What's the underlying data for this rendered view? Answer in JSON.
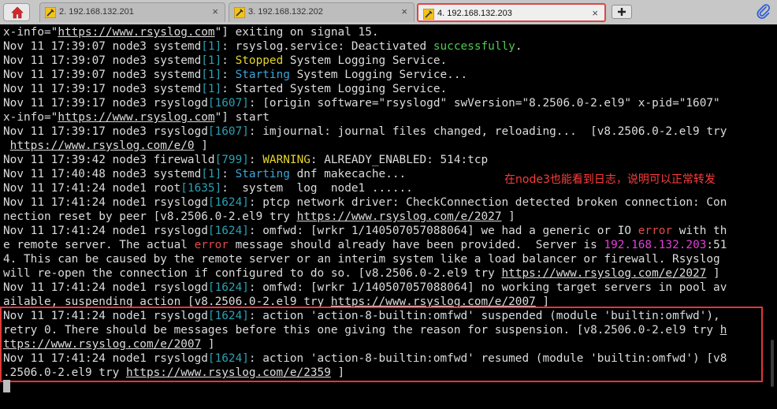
{
  "tabs": {
    "items": [
      {
        "label": "2. 192.168.132.201",
        "close": "×",
        "active": false
      },
      {
        "label": "3. 192.168.132.202",
        "close": "×",
        "active": false
      },
      {
        "label": "4. 192.168.132.203",
        "close": "×",
        "active": true
      }
    ],
    "new_tab_icon": "plus-icon",
    "home_icon": "home-icon",
    "attach_icon": "paperclip-icon"
  },
  "colors": {
    "url": "#dcdcdc",
    "pid": "#2aa1b3",
    "success": "#4fc94f",
    "warning": "#e5d52a",
    "starting": "#3aa6d8",
    "error": "#e24a4a",
    "ip": "#e040d8",
    "annotation": "#ff3b3b",
    "highlight_border": "#e03838"
  },
  "annotation": "在node3也能看到日志，说明可以正常转发",
  "terminal": {
    "lines": [
      [
        {
          "t": "x-info=\""
        },
        {
          "t": "https://www.rsyslog.com",
          "c": "url"
        },
        {
          "t": "\"] exiting on signal 15."
        }
      ],
      [
        {
          "t": "Nov 11 17:39:07 node3 systemd"
        },
        {
          "t": "[1]",
          "c": "num"
        },
        {
          "t": ": rsyslog.service: Deactivated "
        },
        {
          "t": "successfully",
          "c": "green"
        },
        {
          "t": "."
        }
      ],
      [
        {
          "t": "Nov 11 17:39:07 node3 systemd"
        },
        {
          "t": "[1]",
          "c": "num"
        },
        {
          "t": ": "
        },
        {
          "t": "Stopped",
          "c": "yellow"
        },
        {
          "t": " System Logging Service."
        }
      ],
      [
        {
          "t": "Nov 11 17:39:07 node3 systemd"
        },
        {
          "t": "[1]",
          "c": "num"
        },
        {
          "t": ": "
        },
        {
          "t": "Starting",
          "c": "cyan"
        },
        {
          "t": " System Logging Service..."
        }
      ],
      [
        {
          "t": "Nov 11 17:39:17 node3 systemd"
        },
        {
          "t": "[1]",
          "c": "num"
        },
        {
          "t": ": Started System Logging Service."
        }
      ],
      [
        {
          "t": "Nov 11 17:39:17 node3 rsyslogd"
        },
        {
          "t": "[1607]",
          "c": "num"
        },
        {
          "t": ": [origin software=\"rsyslogd\" swVersion=\"8.2506.0-2.el9\" x-pid=\"1607\""
        }
      ],
      [
        {
          "t": "x-info=\""
        },
        {
          "t": "https://www.rsyslog.com",
          "c": "url"
        },
        {
          "t": "\"] start"
        }
      ],
      [
        {
          "t": "Nov 11 17:39:17 node3 rsyslogd"
        },
        {
          "t": "[1607]",
          "c": "num"
        },
        {
          "t": ": imjournal: journal files changed, reloading...  [v8.2506.0-2.el9 try"
        }
      ],
      [
        {
          "t": " "
        },
        {
          "t": "https://www.rsyslog.com/e/0",
          "c": "url"
        },
        {
          "t": " ]"
        }
      ],
      [
        {
          "t": "Nov 11 17:39:42 node3 firewalld"
        },
        {
          "t": "[799]",
          "c": "num"
        },
        {
          "t": ": "
        },
        {
          "t": "WARNING",
          "c": "yellow"
        },
        {
          "t": ": ALREADY_ENABLED: 514:tcp"
        }
      ],
      [
        {
          "t": "Nov 11 17:40:48 node3 systemd"
        },
        {
          "t": "[1]",
          "c": "num"
        },
        {
          "t": ": "
        },
        {
          "t": "Starting",
          "c": "cyan"
        },
        {
          "t": " dnf makecache..."
        }
      ],
      [
        {
          "t": "Nov 11 17:41:24 node1 root"
        },
        {
          "t": "[1635]",
          "c": "num"
        },
        {
          "t": ":  system  log  node1 ......"
        }
      ],
      [
        {
          "t": "Nov 11 17:41:24 node1 rsyslogd"
        },
        {
          "t": "[1624]",
          "c": "num"
        },
        {
          "t": ": ptcp network driver: CheckConnection detected broken connection: Con"
        }
      ],
      [
        {
          "t": "nection reset by peer [v8.2506.0-2.el9 try "
        },
        {
          "t": "https://www.rsyslog.com/e/2027",
          "c": "url"
        },
        {
          "t": " ]"
        }
      ],
      [
        {
          "t": "Nov 11 17:41:24 node1 rsyslogd"
        },
        {
          "t": "[1624]",
          "c": "num"
        },
        {
          "t": ": omfwd: [wrkr 1/140507057088064] we had a generic or IO "
        },
        {
          "t": "error",
          "c": "red"
        },
        {
          "t": " with th"
        }
      ],
      [
        {
          "t": "e remote server. The actual "
        },
        {
          "t": "error",
          "c": "red"
        },
        {
          "t": " message should already have been provided.  Server is "
        },
        {
          "t": "192.168.132.203",
          "c": "magenta"
        },
        {
          "t": ":51"
        }
      ],
      [
        {
          "t": "4. This can be caused by the remote server or an interim system like a load balancer or firewall. Rsyslog"
        }
      ],
      [
        {
          "t": "will re-open the connection if configured to do so. [v8.2506.0-2.el9 try "
        },
        {
          "t": "https://www.rsyslog.com/e/2027",
          "c": "url"
        },
        {
          "t": " ]"
        }
      ],
      [
        {
          "t": "Nov 11 17:41:24 node1 rsyslogd"
        },
        {
          "t": "[1624]",
          "c": "num"
        },
        {
          "t": ": omfwd: [wrkr 1/140507057088064] no working target servers in pool av"
        }
      ],
      [
        {
          "t": "ailable, suspending action [v8.2506.0-2.el9 try "
        },
        {
          "t": "https://www.rsyslog.com/e/2007",
          "c": "url"
        },
        {
          "t": " ]"
        }
      ],
      [
        {
          "t": "Nov 11 17:41:24 node1 rsyslogd"
        },
        {
          "t": "[1624]",
          "c": "num"
        },
        {
          "t": ": action 'action-8-builtin:omfwd' suspended (module 'builtin:omfwd'),"
        }
      ],
      [
        {
          "t": "retry 0. There should be messages before this one giving the reason for suspension. [v8.2506.0-2.el9 try "
        },
        {
          "t": "h",
          "c": "url"
        }
      ],
      [
        {
          "t": "ttps://www.rsyslog.com/e/2007",
          "c": "url"
        },
        {
          "t": " ]"
        }
      ],
      [
        {
          "t": "Nov 11 17:41:24 node1 rsyslogd"
        },
        {
          "t": "[1624]",
          "c": "num"
        },
        {
          "t": ": action 'action-8-builtin:omfwd' resumed (module 'builtin:omfwd') [v8"
        }
      ],
      [
        {
          "t": ".2506.0-2.el9 try "
        },
        {
          "t": "https://www.rsyslog.com/e/2359",
          "c": "url"
        },
        {
          "t": " ]"
        }
      ]
    ]
  }
}
